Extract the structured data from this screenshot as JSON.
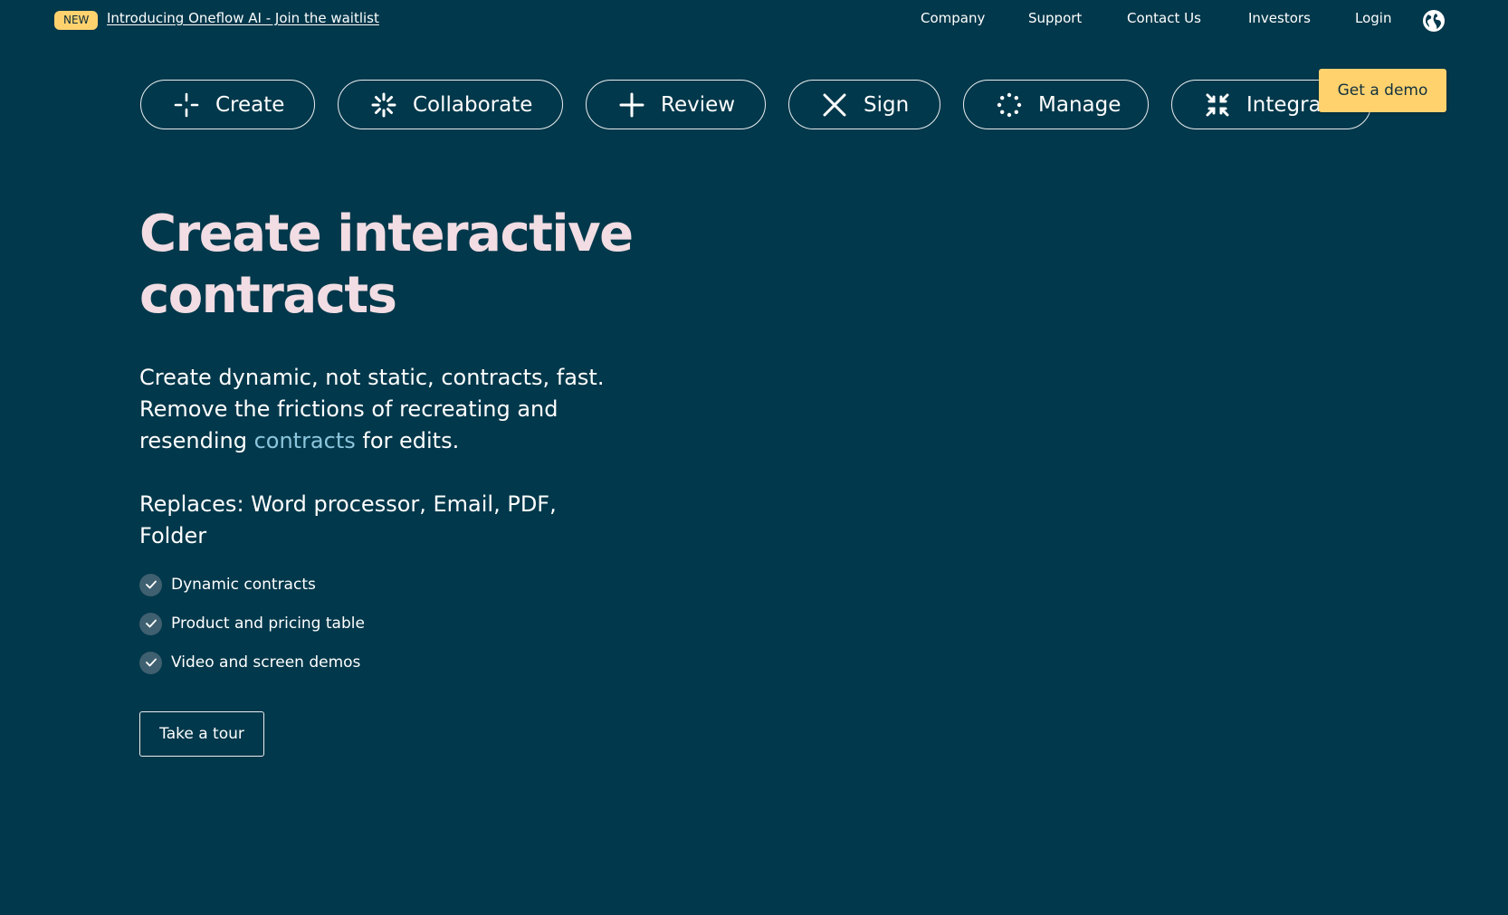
{
  "announcement": {
    "badge": "NEW",
    "link_text": "Introducing Oneflow AI - Join the waitlist"
  },
  "top_nav": {
    "items": [
      "Company",
      "Support",
      "Contact Us",
      "Investors",
      "Login"
    ],
    "globe_icon": "globe-icon"
  },
  "tabs": [
    {
      "label": "Create",
      "icon": "create-sparkle-icon"
    },
    {
      "label": "Collaborate",
      "icon": "collaborate-burst-icon"
    },
    {
      "label": "Review",
      "icon": "review-plus-icon"
    },
    {
      "label": "Sign",
      "icon": "sign-x-icon"
    },
    {
      "label": "Manage",
      "icon": "manage-dots-circle-icon"
    },
    {
      "label": "Integrat",
      "icon": "integrate-arrows-icon"
    }
  ],
  "cta": {
    "demo_label": "Get a demo"
  },
  "hero": {
    "title_line1": "Create interactive",
    "title_line2": "contracts",
    "desc_before": "Create dynamic, not static, contracts, fast. Remove the frictions of recreating and resending ",
    "desc_link": "contracts",
    "desc_after": " for edits.",
    "replaces": "Replaces: Word processor, Email, PDF, Folder",
    "features": [
      "Dynamic contracts",
      "Product and pricing table",
      "Video and screen demos"
    ],
    "tour_label": "Take a tour"
  },
  "colors": {
    "background": "#02384b",
    "accent_yellow": "#ffd26e",
    "title_pink": "#f1dde3",
    "link_blue": "#8cc6de"
  }
}
